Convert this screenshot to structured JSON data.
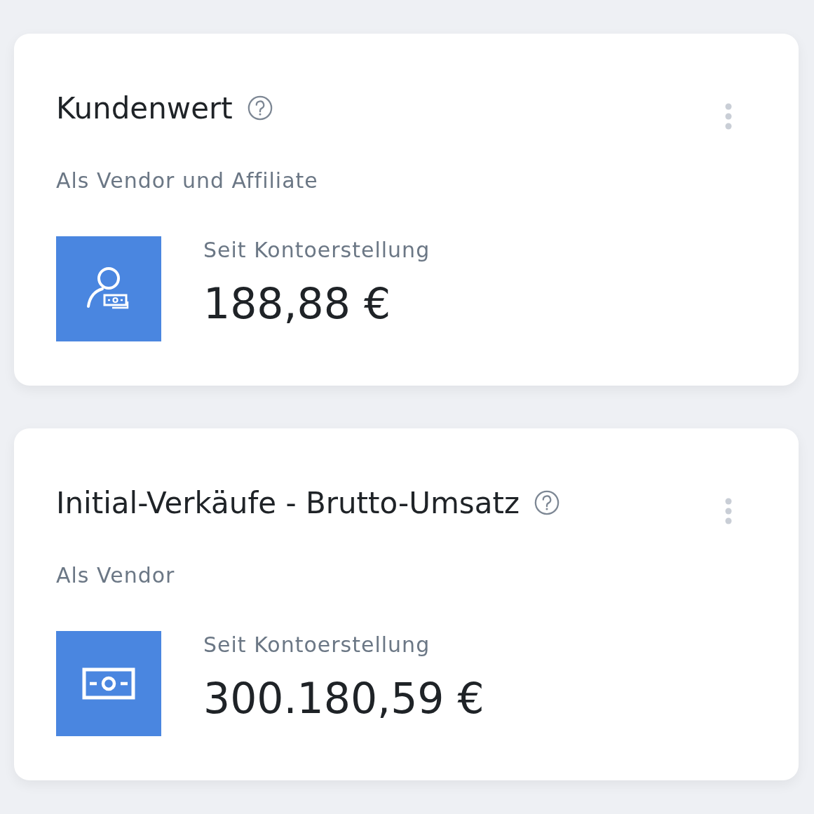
{
  "cards": [
    {
      "title": "Kundenwert",
      "subtitle": "Als Vendor und Affiliate",
      "kind": "customer",
      "label": "Seit Kontoerstellung",
      "value": "188,88 €"
    },
    {
      "title": "Initial-Verkäufe - Brutto-Umsatz",
      "subtitle": "Als Vendor",
      "kind": "money",
      "label": "Seit Kontoerstellung",
      "value": "300.180,59 €"
    }
  ]
}
